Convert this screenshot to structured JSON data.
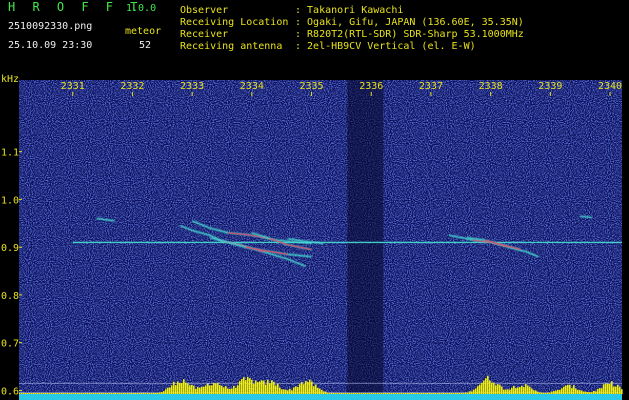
{
  "header": {
    "app_title": "H R O F F T",
    "app_version": "1.0.0",
    "filename": "2510092330.png",
    "datetime": "25.10.09 23:30",
    "counter_label": "meteor",
    "counter_value": "52",
    "info": [
      {
        "label": "Observer",
        "value": ": Takanori Kawachi"
      },
      {
        "label": "Receiving Location",
        "value": ": Ogaki, Gifu, JAPAN (136.60E, 35.35N)"
      },
      {
        "label": "Receiver",
        "value": ": R820T2(RTL-SDR) SDR-Sharp 53.1000MHz"
      },
      {
        "label": "Receiving antenna",
        "value": ": 2el-HB9CV Vertical (el. E-W)"
      }
    ]
  },
  "colors": {
    "background": "#000000",
    "spectrum_dark": "#0a0d5a",
    "axis_text": "#e7e21c",
    "header_green": "#43e84a",
    "carrier": "#44d8d0",
    "echo_red": "#e04060",
    "baseline_cyan": "#28c8e8",
    "histogram": "#f0f000"
  },
  "chart_data": {
    "type": "heatmap",
    "xlabel": "",
    "ylabel": "kHz",
    "x_ticks": [
      "2331",
      "2332",
      "2333",
      "2334",
      "2335",
      "2336",
      "2337",
      "2338",
      "2339",
      "2340"
    ],
    "x_range": [
      2330.1,
      2340.2
    ],
    "y_ticks": [
      "1.1",
      "1.0",
      "0.9",
      "0.8",
      "0.7",
      "0.6"
    ],
    "ylim": [
      0.58,
      1.25
    ],
    "carrier_khz": 0.91,
    "carrier_x_range": [
      2331.0,
      2340.2
    ],
    "dark_gap_x_range": [
      2335.6,
      2336.2
    ],
    "echoes": [
      {
        "x": [
          2332.8,
          2333.0,
          2333.3,
          2333.5,
          2333.8,
          2334.2,
          2334.6,
          2334.9
        ],
        "y": [
          0.945,
          0.935,
          0.925,
          0.913,
          0.905,
          0.89,
          0.875,
          0.86
        ]
      },
      {
        "x": [
          2333.0,
          2333.3,
          2333.6,
          2334.0,
          2334.4,
          2334.8,
          2335.0
        ],
        "y": [
          0.955,
          0.94,
          0.93,
          0.925,
          0.915,
          0.91,
          0.908
        ]
      },
      {
        "x": [
          2333.3,
          2333.6,
          2333.9,
          2334.2,
          2334.6,
          2335.0
        ],
        "y": [
          0.92,
          0.91,
          0.9,
          0.893,
          0.885,
          0.88
        ]
      },
      {
        "x": [
          2334.0,
          2334.3,
          2334.6,
          2335.0
        ],
        "y": [
          0.93,
          0.918,
          0.905,
          0.895
        ]
      },
      {
        "x": [
          2334.6,
          2334.9,
          2335.2
        ],
        "y": [
          0.918,
          0.912,
          0.908
        ]
      },
      {
        "x": [
          2331.4,
          2331.7
        ],
        "y": [
          0.96,
          0.955
        ]
      },
      {
        "x": [
          2337.3,
          2337.5,
          2337.7,
          2338.0,
          2338.3,
          2338.6,
          2338.8
        ],
        "y": [
          0.925,
          0.92,
          0.915,
          0.91,
          0.9,
          0.89,
          0.88
        ]
      },
      {
        "x": [
          2337.6,
          2337.9,
          2338.2,
          2338.5
        ],
        "y": [
          0.92,
          0.915,
          0.905,
          0.895
        ]
      },
      {
        "x": [
          2339.5,
          2339.7
        ],
        "y": [
          0.965,
          0.962
        ]
      }
    ],
    "ref_lines_khz": [
      0.615,
      0.595
    ],
    "activity_peaks": [
      {
        "x": 2332.8,
        "v": 0.55
      },
      {
        "x": 2333.35,
        "v": 0.45
      },
      {
        "x": 2333.9,
        "v": 0.55
      },
      {
        "x": 2334.3,
        "v": 0.45
      },
      {
        "x": 2334.9,
        "v": 0.5
      },
      {
        "x": 2337.95,
        "v": 0.6
      },
      {
        "x": 2338.5,
        "v": 0.35
      },
      {
        "x": 2339.3,
        "v": 0.3
      },
      {
        "x": 2340.0,
        "v": 0.4
      }
    ]
  }
}
